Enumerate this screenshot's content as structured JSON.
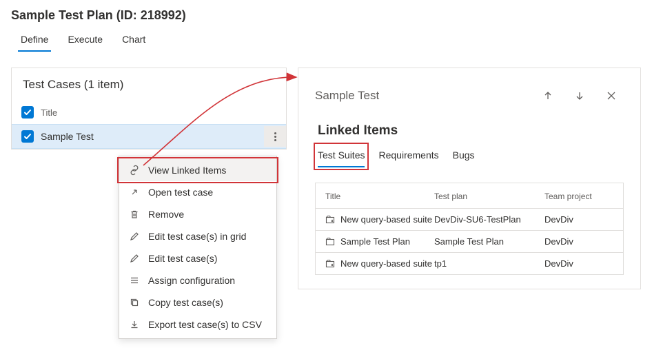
{
  "header": {
    "title": "Sample Test Plan (ID: 218992)"
  },
  "main_tabs": {
    "define": "Define",
    "execute": "Execute",
    "chart": "Chart"
  },
  "test_cases": {
    "title": "Test Cases (1 item)",
    "column_title": "Title",
    "rows": [
      {
        "title": "Sample Test"
      }
    ]
  },
  "context_menu": {
    "view_linked": "View Linked Items",
    "open": "Open test case",
    "remove": "Remove",
    "edit_grid": "Edit test case(s) in grid",
    "edit": "Edit test case(s)",
    "assign_config": "Assign configuration",
    "copy": "Copy test case(s)",
    "export_csv": "Export test case(s) to CSV"
  },
  "linked_panel": {
    "title": "Sample Test",
    "section": "Linked Items",
    "tabs": {
      "suites": "Test Suites",
      "requirements": "Requirements",
      "bugs": "Bugs"
    },
    "columns": {
      "title": "Title",
      "plan": "Test plan",
      "project": "Team project"
    },
    "rows": [
      {
        "icon": "query",
        "title": "New query-based suite",
        "plan": "DevDiv-SU6-TestPlan",
        "project": "DevDiv"
      },
      {
        "icon": "static",
        "title": "Sample Test Plan",
        "plan": "Sample Test Plan",
        "project": "DevDiv"
      },
      {
        "icon": "query",
        "title": "New query-based suite",
        "plan": "tp1",
        "project": "DevDiv"
      }
    ]
  }
}
